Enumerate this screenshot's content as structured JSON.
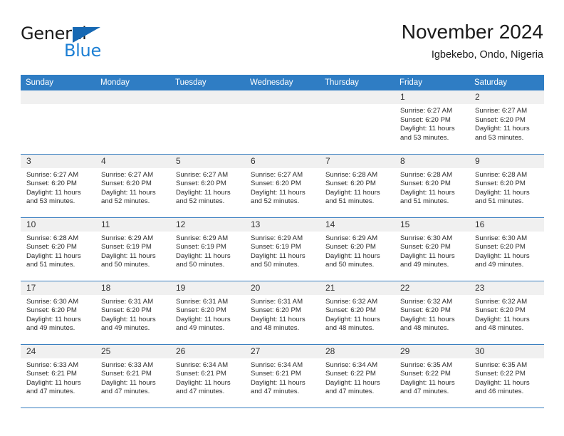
{
  "brand": {
    "name_part1": "General",
    "name_part2": "Blue",
    "triangle_icon": "triangle-icon",
    "accent_color": "#1c7fd4",
    "logo_triangle_color": "#1668b3"
  },
  "header": {
    "title": "November 2024",
    "subtitle": "Igbekebo, Ondo, Nigeria"
  },
  "theme": {
    "header_bar_color": "#2f7dc4",
    "daynum_strip_color": "#f0f0f0",
    "grid_line_color": "#3a7fc0",
    "text_color": "#2b2b2b"
  },
  "weekday_headers": [
    "Sunday",
    "Monday",
    "Tuesday",
    "Wednesday",
    "Thursday",
    "Friday",
    "Saturday"
  ],
  "weeks": [
    [
      {
        "day": "",
        "sunrise": "",
        "sunset": "",
        "daylight_line1": "",
        "daylight_line2": "",
        "empty": true
      },
      {
        "day": "",
        "sunrise": "",
        "sunset": "",
        "daylight_line1": "",
        "daylight_line2": "",
        "empty": true
      },
      {
        "day": "",
        "sunrise": "",
        "sunset": "",
        "daylight_line1": "",
        "daylight_line2": "",
        "empty": true
      },
      {
        "day": "",
        "sunrise": "",
        "sunset": "",
        "daylight_line1": "",
        "daylight_line2": "",
        "empty": true
      },
      {
        "day": "",
        "sunrise": "",
        "sunset": "",
        "daylight_line1": "",
        "daylight_line2": "",
        "empty": true
      },
      {
        "day": "1",
        "sunrise": "Sunrise: 6:27 AM",
        "sunset": "Sunset: 6:20 PM",
        "daylight_line1": "Daylight: 11 hours",
        "daylight_line2": "and 53 minutes."
      },
      {
        "day": "2",
        "sunrise": "Sunrise: 6:27 AM",
        "sunset": "Sunset: 6:20 PM",
        "daylight_line1": "Daylight: 11 hours",
        "daylight_line2": "and 53 minutes."
      }
    ],
    [
      {
        "day": "3",
        "sunrise": "Sunrise: 6:27 AM",
        "sunset": "Sunset: 6:20 PM",
        "daylight_line1": "Daylight: 11 hours",
        "daylight_line2": "and 53 minutes."
      },
      {
        "day": "4",
        "sunrise": "Sunrise: 6:27 AM",
        "sunset": "Sunset: 6:20 PM",
        "daylight_line1": "Daylight: 11 hours",
        "daylight_line2": "and 52 minutes."
      },
      {
        "day": "5",
        "sunrise": "Sunrise: 6:27 AM",
        "sunset": "Sunset: 6:20 PM",
        "daylight_line1": "Daylight: 11 hours",
        "daylight_line2": "and 52 minutes."
      },
      {
        "day": "6",
        "sunrise": "Sunrise: 6:27 AM",
        "sunset": "Sunset: 6:20 PM",
        "daylight_line1": "Daylight: 11 hours",
        "daylight_line2": "and 52 minutes."
      },
      {
        "day": "7",
        "sunrise": "Sunrise: 6:28 AM",
        "sunset": "Sunset: 6:20 PM",
        "daylight_line1": "Daylight: 11 hours",
        "daylight_line2": "and 51 minutes."
      },
      {
        "day": "8",
        "sunrise": "Sunrise: 6:28 AM",
        "sunset": "Sunset: 6:20 PM",
        "daylight_line1": "Daylight: 11 hours",
        "daylight_line2": "and 51 minutes."
      },
      {
        "day": "9",
        "sunrise": "Sunrise: 6:28 AM",
        "sunset": "Sunset: 6:20 PM",
        "daylight_line1": "Daylight: 11 hours",
        "daylight_line2": "and 51 minutes."
      }
    ],
    [
      {
        "day": "10",
        "sunrise": "Sunrise: 6:28 AM",
        "sunset": "Sunset: 6:20 PM",
        "daylight_line1": "Daylight: 11 hours",
        "daylight_line2": "and 51 minutes."
      },
      {
        "day": "11",
        "sunrise": "Sunrise: 6:29 AM",
        "sunset": "Sunset: 6:19 PM",
        "daylight_line1": "Daylight: 11 hours",
        "daylight_line2": "and 50 minutes."
      },
      {
        "day": "12",
        "sunrise": "Sunrise: 6:29 AM",
        "sunset": "Sunset: 6:19 PM",
        "daylight_line1": "Daylight: 11 hours",
        "daylight_line2": "and 50 minutes."
      },
      {
        "day": "13",
        "sunrise": "Sunrise: 6:29 AM",
        "sunset": "Sunset: 6:19 PM",
        "daylight_line1": "Daylight: 11 hours",
        "daylight_line2": "and 50 minutes."
      },
      {
        "day": "14",
        "sunrise": "Sunrise: 6:29 AM",
        "sunset": "Sunset: 6:20 PM",
        "daylight_line1": "Daylight: 11 hours",
        "daylight_line2": "and 50 minutes."
      },
      {
        "day": "15",
        "sunrise": "Sunrise: 6:30 AM",
        "sunset": "Sunset: 6:20 PM",
        "daylight_line1": "Daylight: 11 hours",
        "daylight_line2": "and 49 minutes."
      },
      {
        "day": "16",
        "sunrise": "Sunrise: 6:30 AM",
        "sunset": "Sunset: 6:20 PM",
        "daylight_line1": "Daylight: 11 hours",
        "daylight_line2": "and 49 minutes."
      }
    ],
    [
      {
        "day": "17",
        "sunrise": "Sunrise: 6:30 AM",
        "sunset": "Sunset: 6:20 PM",
        "daylight_line1": "Daylight: 11 hours",
        "daylight_line2": "and 49 minutes."
      },
      {
        "day": "18",
        "sunrise": "Sunrise: 6:31 AM",
        "sunset": "Sunset: 6:20 PM",
        "daylight_line1": "Daylight: 11 hours",
        "daylight_line2": "and 49 minutes."
      },
      {
        "day": "19",
        "sunrise": "Sunrise: 6:31 AM",
        "sunset": "Sunset: 6:20 PM",
        "daylight_line1": "Daylight: 11 hours",
        "daylight_line2": "and 49 minutes."
      },
      {
        "day": "20",
        "sunrise": "Sunrise: 6:31 AM",
        "sunset": "Sunset: 6:20 PM",
        "daylight_line1": "Daylight: 11 hours",
        "daylight_line2": "and 48 minutes."
      },
      {
        "day": "21",
        "sunrise": "Sunrise: 6:32 AM",
        "sunset": "Sunset: 6:20 PM",
        "daylight_line1": "Daylight: 11 hours",
        "daylight_line2": "and 48 minutes."
      },
      {
        "day": "22",
        "sunrise": "Sunrise: 6:32 AM",
        "sunset": "Sunset: 6:20 PM",
        "daylight_line1": "Daylight: 11 hours",
        "daylight_line2": "and 48 minutes."
      },
      {
        "day": "23",
        "sunrise": "Sunrise: 6:32 AM",
        "sunset": "Sunset: 6:20 PM",
        "daylight_line1": "Daylight: 11 hours",
        "daylight_line2": "and 48 minutes."
      }
    ],
    [
      {
        "day": "24",
        "sunrise": "Sunrise: 6:33 AM",
        "sunset": "Sunset: 6:21 PM",
        "daylight_line1": "Daylight: 11 hours",
        "daylight_line2": "and 47 minutes."
      },
      {
        "day": "25",
        "sunrise": "Sunrise: 6:33 AM",
        "sunset": "Sunset: 6:21 PM",
        "daylight_line1": "Daylight: 11 hours",
        "daylight_line2": "and 47 minutes."
      },
      {
        "day": "26",
        "sunrise": "Sunrise: 6:34 AM",
        "sunset": "Sunset: 6:21 PM",
        "daylight_line1": "Daylight: 11 hours",
        "daylight_line2": "and 47 minutes."
      },
      {
        "day": "27",
        "sunrise": "Sunrise: 6:34 AM",
        "sunset": "Sunset: 6:21 PM",
        "daylight_line1": "Daylight: 11 hours",
        "daylight_line2": "and 47 minutes."
      },
      {
        "day": "28",
        "sunrise": "Sunrise: 6:34 AM",
        "sunset": "Sunset: 6:22 PM",
        "daylight_line1": "Daylight: 11 hours",
        "daylight_line2": "and 47 minutes."
      },
      {
        "day": "29",
        "sunrise": "Sunrise: 6:35 AM",
        "sunset": "Sunset: 6:22 PM",
        "daylight_line1": "Daylight: 11 hours",
        "daylight_line2": "and 47 minutes."
      },
      {
        "day": "30",
        "sunrise": "Sunrise: 6:35 AM",
        "sunset": "Sunset: 6:22 PM",
        "daylight_line1": "Daylight: 11 hours",
        "daylight_line2": "and 46 minutes."
      }
    ]
  ]
}
